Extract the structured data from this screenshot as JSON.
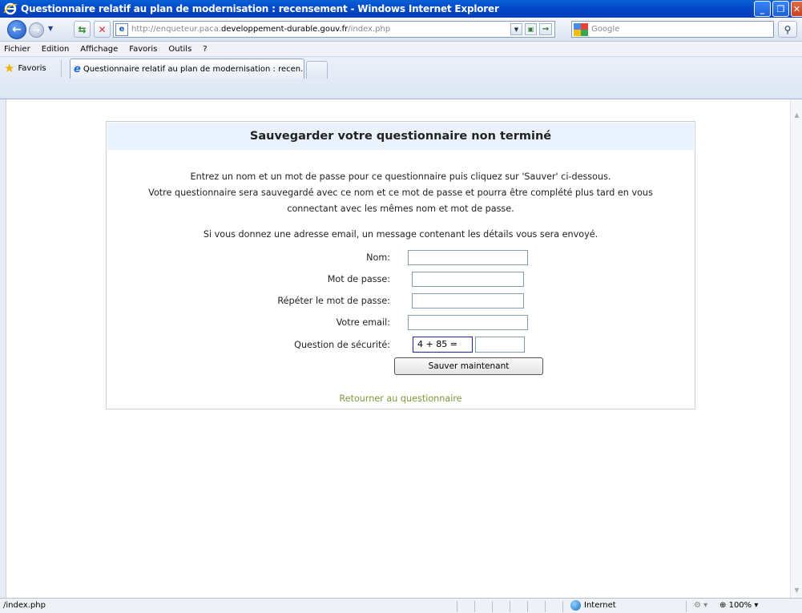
{
  "window": {
    "title": "Questionnaire relatif au plan de modernisation : recensement - Windows Internet Explorer"
  },
  "addressbar": {
    "url_prefix": "http://enqueteur.paca.",
    "url_domain": "developpement-durable.gouv.fr",
    "url_path": "/index.php",
    "search_placeholder": "Google"
  },
  "menu": {
    "items": [
      {
        "label": "Fichier"
      },
      {
        "label": "Edition"
      },
      {
        "label": "Affichage"
      },
      {
        "label": "Favoris"
      },
      {
        "label": "Outils"
      },
      {
        "label": "?"
      }
    ]
  },
  "tabs": {
    "favorites_label": "Favoris",
    "active_tab_label": "Questionnaire relatif au plan de modernisation : recen..."
  },
  "page": {
    "heading": "Sauvegarder votre questionnaire non terminé",
    "intro_line1": "Entrez un nom et un mot de passe pour ce questionnaire puis cliquez sur 'Sauver' ci-dessous.",
    "intro_line2": "Votre questionnaire sera sauvegardé avec ce nom et ce mot de passe et pourra être complété plus tard en vous",
    "intro_line3": "connectant avec les mêmes nom et mot de passe.",
    "email_note": "Si vous donnez une adresse email, un message contenant les détails vous sera envoyé.",
    "fields": {
      "name_label": "Nom:",
      "password_label": "Mot de passe:",
      "password_repeat_label": "Répéter le mot de passe:",
      "email_label": "Votre email:",
      "security_label": "Question de sécurité:",
      "security_question": "4 + 85 ="
    },
    "save_button": "Sauver maintenant",
    "back_link": "Retourner au questionnaire"
  },
  "status": {
    "text": "/index.php",
    "zone": "Internet",
    "zoom": "100%"
  },
  "colors": {
    "title_bar": "#0047c8",
    "panel_header": "#eaf3fd",
    "link": "#7d9a3b"
  }
}
